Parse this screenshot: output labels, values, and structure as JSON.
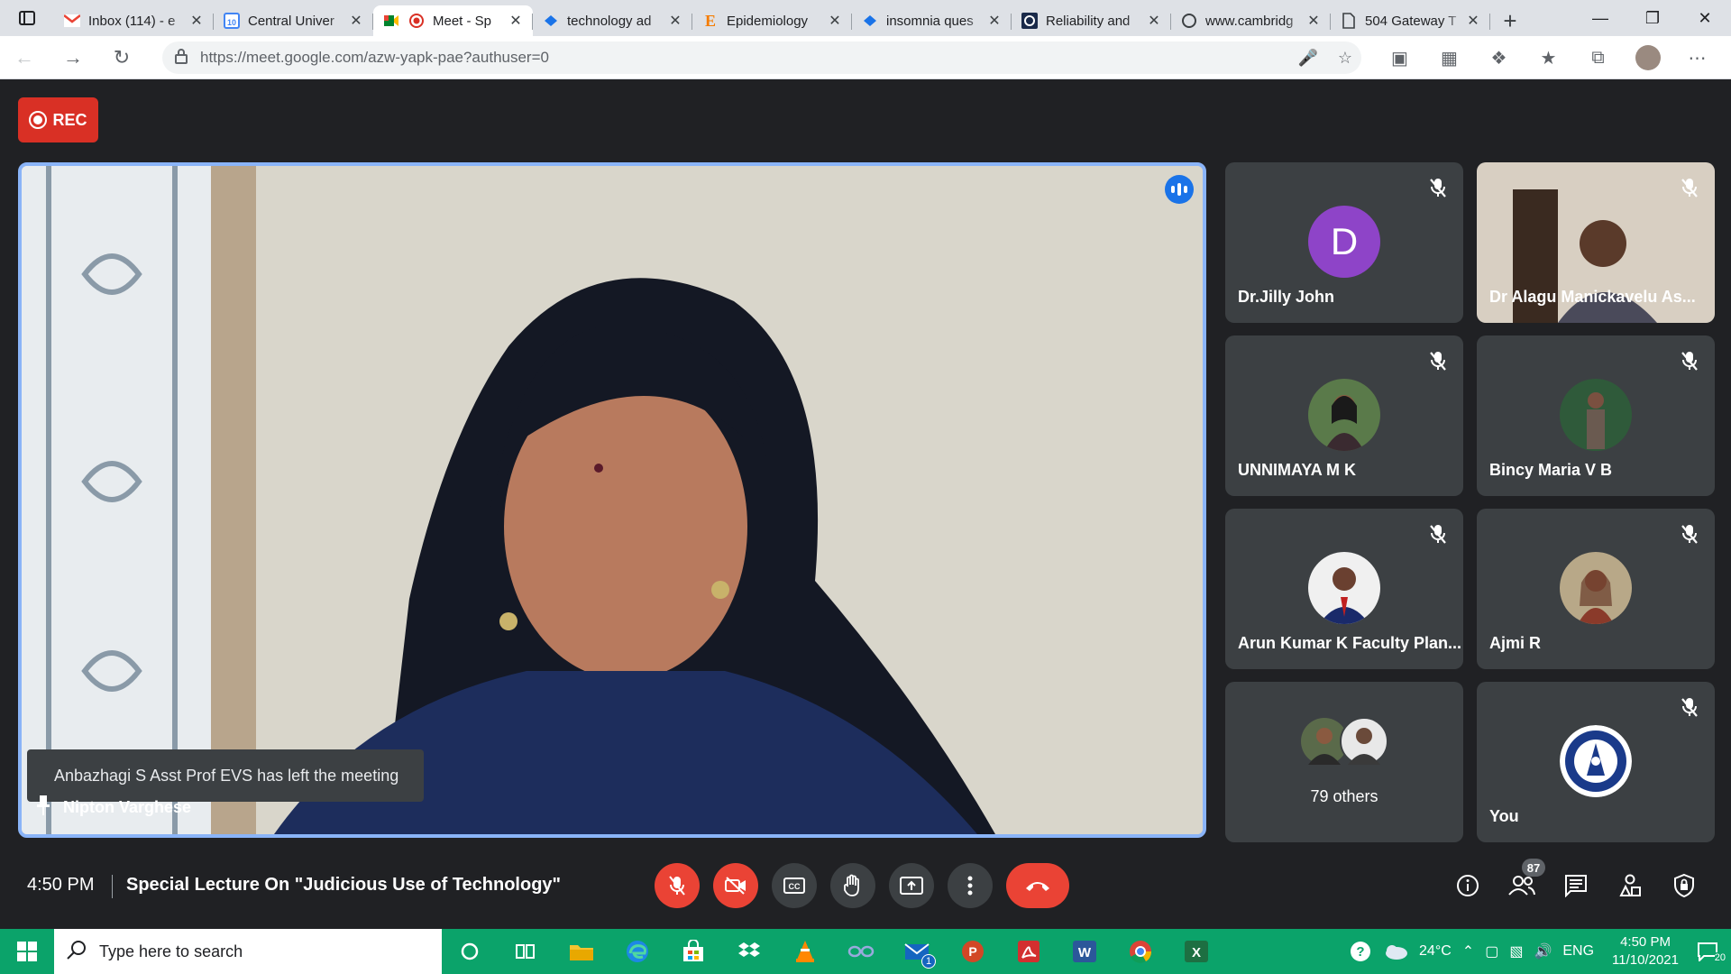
{
  "browser": {
    "tabs": [
      {
        "label": "Inbox (114) - e",
        "favicon": "gmail-icon",
        "active": false
      },
      {
        "label": "Central Univer",
        "favicon": "calendar-icon",
        "active": false
      },
      {
        "label": "Meet - Sp",
        "favicon": "meet-icon",
        "active": true
      },
      {
        "label": "technology ad",
        "favicon": "bing-icon",
        "active": false
      },
      {
        "label": "Epidemiology",
        "favicon": "e-icon",
        "active": false
      },
      {
        "label": "insomnia ques",
        "favicon": "bing-icon",
        "active": false
      },
      {
        "label": "Reliability and",
        "favicon": "c-icon",
        "active": false
      },
      {
        "label": "www.cambridg",
        "favicon": "link-icon",
        "active": false
      },
      {
        "label": "504 Gateway T",
        "favicon": "page-icon",
        "active": false
      }
    ],
    "url": "https://meet.google.com/azw-yapk-pae?authuser=0"
  },
  "meet": {
    "rec_label": "REC",
    "main_speaker": "Nipton Varghese",
    "toast": "Anbazhagi S Asst Prof EVS has left the meeting",
    "participants": [
      {
        "name": "Dr.Jilly John",
        "avatar": "D",
        "muted": true
      },
      {
        "name": "Dr Alagu Manickavelu As...",
        "avatar": "video",
        "muted": true
      },
      {
        "name": "UNNIMAYA M K",
        "avatar": "photo",
        "muted": true
      },
      {
        "name": "Bincy Maria V B",
        "avatar": "photo",
        "muted": true
      },
      {
        "name": "Arun Kumar K Faculty Plan...",
        "avatar": "photo",
        "muted": true
      },
      {
        "name": "Ajmi R",
        "avatar": "photo",
        "muted": true
      },
      {
        "name": "79 others",
        "avatar": "group",
        "muted": false
      },
      {
        "name": "You",
        "avatar": "logo",
        "muted": true
      }
    ],
    "time": "4:50 PM",
    "title": "Special Lecture On \"Judicious Use of Technology\"",
    "people_count": "87"
  },
  "taskbar": {
    "search_placeholder": "Type here to search",
    "weather": "24°C",
    "lang": "ENG",
    "time": "4:50 PM",
    "date": "11/10/2021",
    "notification_count": "20",
    "mail_badge": "1"
  },
  "colors": {
    "accent": "#1a73e8",
    "danger": "#ea4335",
    "taskbar": "#0ba36a"
  }
}
